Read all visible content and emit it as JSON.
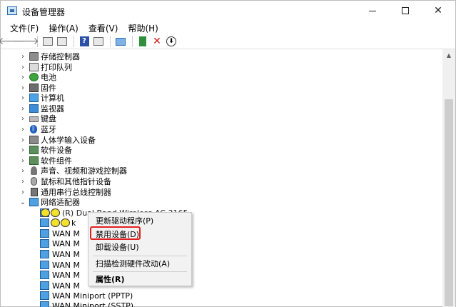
{
  "window": {
    "title": "设备管理器",
    "controls": {
      "minimize_icon": "minimize-icon",
      "maximize_icon": "maximize-icon",
      "close_glyph": "✕"
    }
  },
  "menu": [
    {
      "label": "文件(F)"
    },
    {
      "label": "操作(A)"
    },
    {
      "label": "查看(V)"
    },
    {
      "label": "帮助(H)"
    }
  ],
  "toolbar": {
    "back_glyph": "🡐",
    "forward_glyph": "🡒",
    "help_glyph": "?",
    "uninstall_glyph": "✕",
    "update_glyph": "⬇",
    "icons": [
      "back-arrow-icon",
      "forward-arrow-icon",
      "properties-icon",
      "show-hidden-icon",
      "help-icon",
      "view-icon",
      "monitor-scan-icon",
      "enable-device-icon",
      "uninstall-x-icon",
      "update-driver-icon"
    ]
  },
  "tree": {
    "categories": [
      {
        "label": "存储控制器",
        "icon": "storage-icon"
      },
      {
        "label": "打印队列",
        "icon": "printer-icon"
      },
      {
        "label": "电池",
        "icon": "battery-icon"
      },
      {
        "label": "固件",
        "icon": "firmware-icon"
      },
      {
        "label": "计算机",
        "icon": "computer-icon"
      },
      {
        "label": "监视器",
        "icon": "monitor-icon"
      },
      {
        "label": "键盘",
        "icon": "keyboard-icon"
      },
      {
        "label": "蓝牙",
        "icon": "bluetooth-icon"
      },
      {
        "label": "人体学输入设备",
        "icon": "hid-icon"
      },
      {
        "label": "软件设备",
        "icon": "software-device-icon"
      },
      {
        "label": "软件组件",
        "icon": "software-component-icon"
      },
      {
        "label": "声音、视频和游戏控制器",
        "icon": "audio-icon"
      },
      {
        "label": "鼠标和其他指针设备",
        "icon": "mouse-icon"
      },
      {
        "label": "通用串行总线控制器",
        "icon": "usb-icon"
      }
    ],
    "expanded_category": {
      "label": "网络适配器",
      "icon": "network-adapter-icon"
    },
    "children": [
      {
        "label": "(R) Dual Band Wireless-AC 3165",
        "masked": true
      },
      {
        "label": "k",
        "masked": true
      },
      {
        "label": "WAN M"
      },
      {
        "label": "WAN M"
      },
      {
        "label": "WAN M"
      },
      {
        "label": "WAN M"
      },
      {
        "label": "WAN M"
      },
      {
        "label": "WAN M"
      },
      {
        "label": "WAN Miniport (PPTP)"
      },
      {
        "label": "WAN Miniport (SSTP)"
      }
    ]
  },
  "context_menu": {
    "items": [
      {
        "label": "更新驱动程序(P)"
      },
      {
        "label": "禁用设备(D)"
      },
      {
        "label": "卸载设备(U)"
      },
      {
        "label": "扫描检测硬件改动(A)"
      },
      {
        "label": "属性(R)"
      }
    ],
    "highlight_color": "#e02020"
  },
  "colors": {
    "accent": "#1e5c98",
    "highlight": "#e02020"
  }
}
